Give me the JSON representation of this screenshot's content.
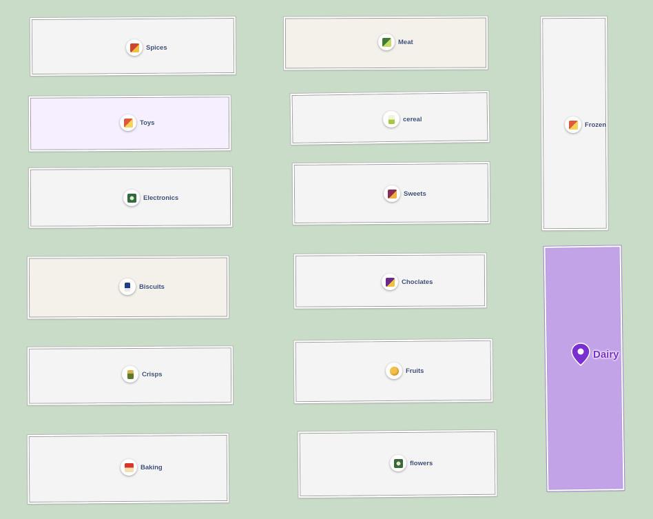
{
  "map": {
    "selected_color": "#c3a3e8",
    "pin_color": "#7a2fd0",
    "background_color": "#c8dcc8"
  },
  "aisles": {
    "spices": {
      "label": "Spices",
      "icon": "spices-product-icon",
      "color": "#d0442f"
    },
    "toys": {
      "label": "Toys",
      "icon": "toys-product-icon",
      "color": "#e05a3a"
    },
    "electronics": {
      "label": "Electronics",
      "icon": "electronics-product-icon",
      "color": "#2e6b3f"
    },
    "biscuits": {
      "label": "Biscuits",
      "icon": "biscuits-product-icon",
      "color": "#1d3f8a"
    },
    "crisps": {
      "label": "Crisps",
      "icon": "crisps-product-icon",
      "color": "#5c7a2a"
    },
    "baking": {
      "label": "Baking",
      "icon": "baking-product-icon",
      "color": "#d8352b"
    },
    "meat": {
      "label": "Meat",
      "icon": "meat-product-icon",
      "color": "#3f7b35"
    },
    "cereal": {
      "label": "cereal",
      "icon": "cereal-product-icon",
      "color": "#a6c843"
    },
    "sweets": {
      "label": "Sweets",
      "icon": "sweets-product-icon",
      "color": "#8a2a55"
    },
    "choclates": {
      "label": "Choclates",
      "icon": "chocolates-product-icon",
      "color": "#6b2a8a"
    },
    "fruits": {
      "label": "Fruits",
      "icon": "fruits-product-icon",
      "color": "#d6902a"
    },
    "flowers": {
      "label": "flowers",
      "icon": "flowers-product-icon",
      "color": "#3a6a3a"
    },
    "frozen": {
      "label": "Frozen",
      "icon": "frozen-product-icon",
      "color": "#e05a3a"
    },
    "dairy": {
      "label": "Dairy",
      "icon": "location-pin-icon",
      "selected": true
    }
  }
}
